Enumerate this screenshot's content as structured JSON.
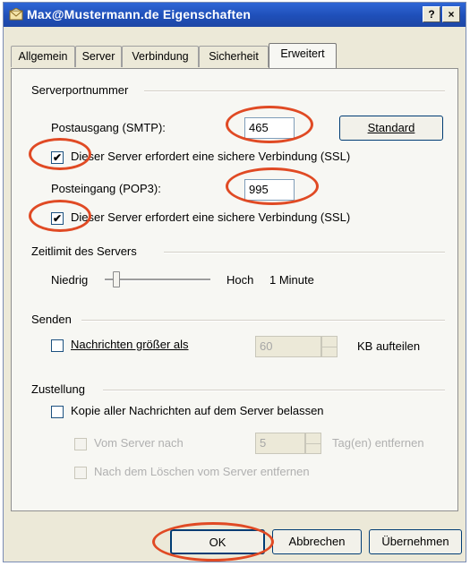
{
  "window": {
    "title": "Max@Mustermann.de Eigenschaften",
    "help_label": "?",
    "close_label": "×"
  },
  "tabs": [
    {
      "label": "Allgemein"
    },
    {
      "label": "Server"
    },
    {
      "label": "Verbindung"
    },
    {
      "label": "Sicherheit"
    },
    {
      "label": "Erweitert"
    }
  ],
  "serverports": {
    "group_label": "Serverportnummer",
    "smtp_label": "Postausgang (SMTP):",
    "smtp_value": "465",
    "standard_button": "Standard",
    "smtp_ssl_label": "Dieser Server erfordert eine sichere Verbindung (SSL)",
    "smtp_ssl_checked": true,
    "pop3_label": "Posteingang (POP3):",
    "pop3_value": "995",
    "pop3_ssl_label": "Dieser Server erfordert eine sichere Verbindung (SSL)",
    "pop3_ssl_checked": true
  },
  "timeout": {
    "group_label": "Zeitlimit des Servers",
    "low_label": "Niedrig",
    "high_label": "Hoch",
    "value_label": "1 Minute",
    "slider_fraction": 0.08
  },
  "send": {
    "group_label": "Senden",
    "split_label": "Nachrichten größer als",
    "split_checked": false,
    "split_value": "60",
    "split_unit": "KB aufteilen"
  },
  "delivery": {
    "group_label": "Zustellung",
    "keep_copy_label": "Kopie aller Nachrichten auf dem Server belassen",
    "keep_copy_checked": false,
    "remove_after_label": "Vom Server nach",
    "remove_after_value": "5",
    "remove_after_unit": "Tag(en) entfernen",
    "remove_on_delete_label": "Nach dem Löschen vom Server entfernen"
  },
  "buttons": {
    "ok": "OK",
    "cancel": "Abbrechen",
    "apply": "Übernehmen"
  },
  "colors": {
    "titlebar": "#2058c8",
    "annotation_circle": "#e04a24"
  }
}
